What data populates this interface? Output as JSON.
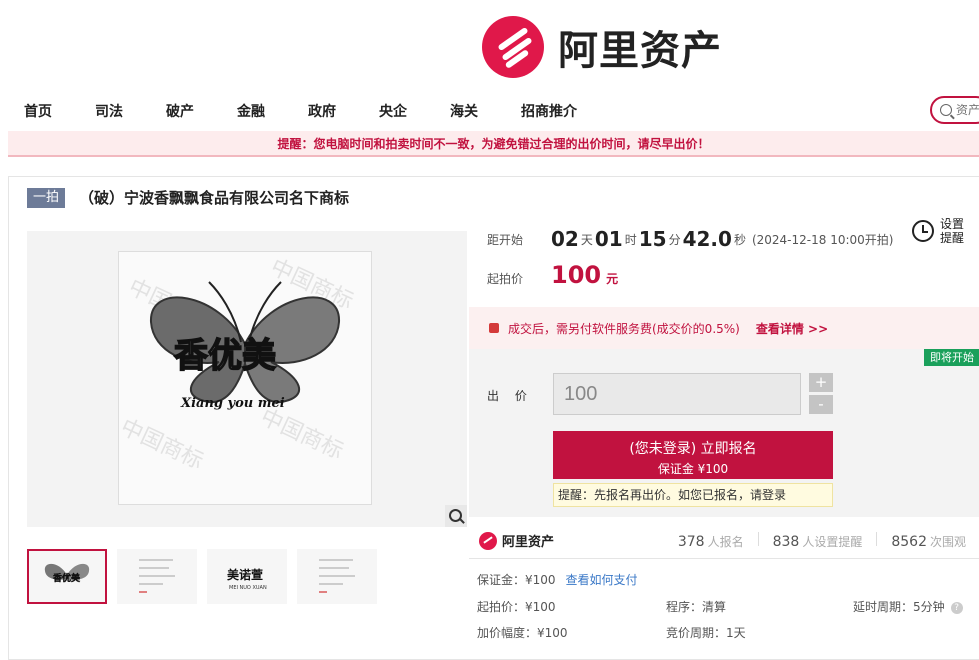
{
  "brand": {
    "name": "阿里资产"
  },
  "nav": {
    "items": [
      {
        "label": "首页"
      },
      {
        "label": "司法"
      },
      {
        "label": "破产"
      },
      {
        "label": "金融"
      },
      {
        "label": "政府"
      },
      {
        "label": "央企"
      },
      {
        "label": "海关"
      },
      {
        "label": "招商推介"
      }
    ],
    "search_placeholder": "资产"
  },
  "warning": {
    "text": "提醒：您电脑时间和拍卖时间不一致，为避免错过合理的出价时间，请尽早出价！"
  },
  "item": {
    "tag": "一拍",
    "title": "（破）宁波香飘飘食品有限公司名下商标",
    "image_texts": {
      "brand_cn": "香优美",
      "brand_pinyin": "Xiang you mei",
      "watermark": "中国商标"
    },
    "thumbnails": [
      {
        "label": "香优美"
      },
      {
        "label": ""
      },
      {
        "label": "美诺萱",
        "sub": "MEI NUO XUAN"
      },
      {
        "label": ""
      }
    ]
  },
  "countdown": {
    "label": "距开始",
    "days": "02",
    "days_unit": "天",
    "hours": "01",
    "hours_unit": "时",
    "minutes": "15",
    "minutes_unit": "分",
    "seconds": "42.0",
    "seconds_unit": "秒",
    "start_note": "(2024-12-18 10:00开拍)"
  },
  "reminder": {
    "label": "设置提醒"
  },
  "price": {
    "label": "起拍价",
    "value": "100",
    "unit": "元"
  },
  "fee": {
    "text": "成交后，需另付软件服务费(成交价的0.5%)",
    "link": "查看详情 >>"
  },
  "bid": {
    "status_badge": "即将开始",
    "label": "出 价",
    "value": "100",
    "plus": "+",
    "minus": "-",
    "register_line1": "(您未登录) 立即报名",
    "register_line2": "保证金 ¥100",
    "tip": "提醒：先报名再出价。如您已报名，请登录"
  },
  "stats": {
    "signups": "378",
    "signups_label": "人报名",
    "reminders": "838",
    "reminders_label": "人设置提醒",
    "views": "8562",
    "views_label": "次围观"
  },
  "details": {
    "deposit": "保证金：¥100",
    "pay_link": "查看如何支付",
    "start_price": "起拍价：¥100",
    "procedure": "程序：清算",
    "delay": "延时周期：5分钟",
    "increment": "加价幅度：¥100",
    "cycle": "竞价周期：1天"
  },
  "colors": {
    "accent": "#c1123f",
    "brand": "#e0184a",
    "badge_green": "#1aa05b"
  }
}
